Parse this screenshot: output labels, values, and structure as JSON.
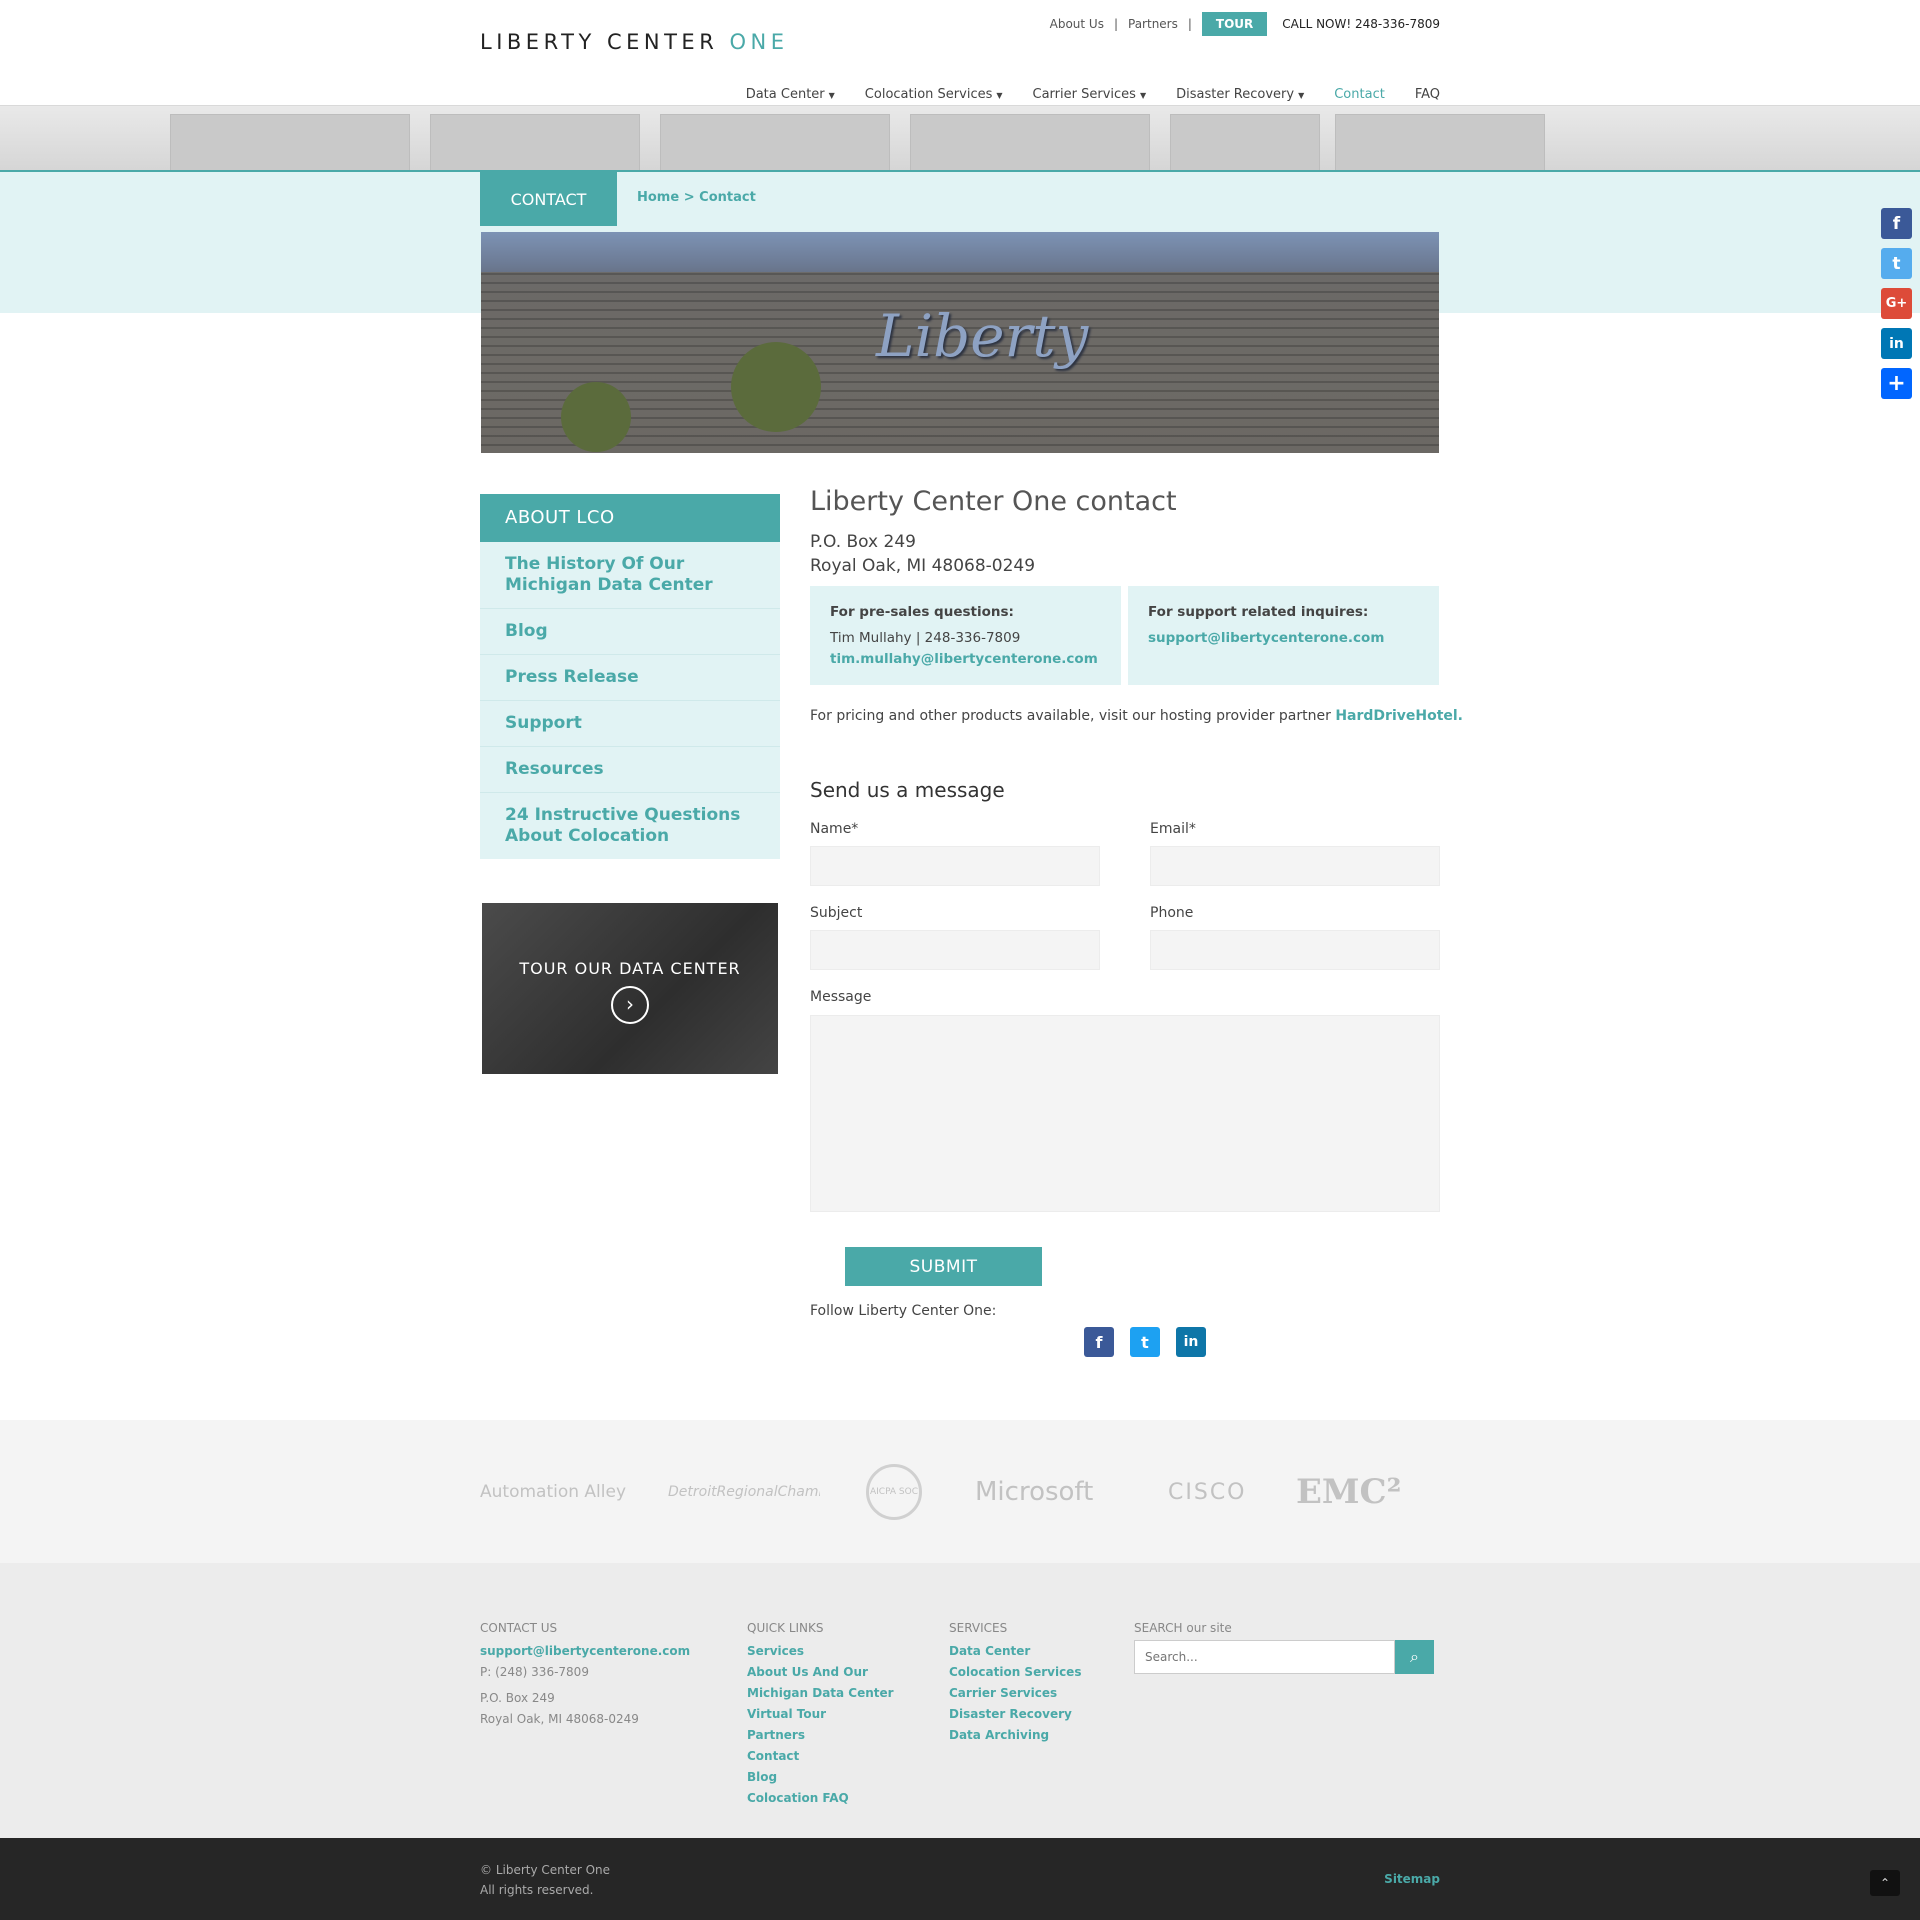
{
  "header": {
    "logo_text": "LIBERTY CENTER ",
    "logo_accent": "ONE",
    "top_links": [
      "About Us",
      "Partners"
    ],
    "tour_label": "TOUR",
    "call_now": "CALL NOW! 248-336-7809",
    "nav": [
      {
        "label": "Data Center"
      },
      {
        "label": "Colocation Services"
      },
      {
        "label": "Carrier Services"
      },
      {
        "label": "Disaster Recovery"
      },
      {
        "label": "Contact"
      },
      {
        "label": "FAQ"
      }
    ]
  },
  "page_tab": "CONTACT",
  "breadcrumb": {
    "home": "Home",
    "sep": ">",
    "current": "Contact"
  },
  "banner_text": "Liberty",
  "sidebar": {
    "heading": "ABOUT LCO",
    "items": [
      "The History Of Our Michigan Data Center",
      "Blog",
      "Press Release",
      "Support",
      "Resources",
      "24 Instructive Questions About Colocation"
    ],
    "tour_box": "TOUR OUR DATA CENTER"
  },
  "main": {
    "title": "Liberty Center One contact",
    "address_line1": "P.O. Box 249",
    "address_line2": "Royal Oak, MI 48068-0249",
    "presales": {
      "heading": "For pre-sales questions:",
      "contact": "Tim Mullahy | 248-336-7809",
      "email": "tim.mullahy@libertycenterone.com"
    },
    "support": {
      "heading": "For support related inquires:",
      "email": "support@libertycenterone.com"
    },
    "pricing_text": "For pricing and other products available, visit our hosting provider partner ",
    "pricing_link": "HardDriveHotel.",
    "form": {
      "title": "Send us a message",
      "name_label": "Name*",
      "email_label": "Email*",
      "subject_label": "Subject",
      "phone_label": "Phone",
      "message_label": "Message",
      "submit_label": "SUBMIT"
    },
    "follow_label": "Follow Liberty Center One:"
  },
  "partners": [
    "Automation Alley",
    "DetroitRegionalChamber",
    "AICPA SOC",
    "Microsoft",
    "CISCO",
    "EMC²"
  ],
  "footer": {
    "contact": {
      "heading": "CONTACT US",
      "email": "support@libertycenterone.com",
      "phone": "P: (248) 336-7809",
      "address1": "P.O. Box 249",
      "address2": "Royal Oak, MI 48068-0249"
    },
    "quick_links": {
      "heading": "QUICK LINKS",
      "items": [
        "Services",
        "About Us And Our",
        "Michigan Data Center",
        "Virtual Tour",
        "Partners",
        "Contact",
        "Blog",
        "Colocation FAQ"
      ]
    },
    "services": {
      "heading": "SERVICES",
      "items": [
        "Data Center",
        "Colocation Services",
        "Carrier Services",
        "Disaster Recovery",
        "Data Archiving"
      ]
    },
    "search": {
      "heading": "SEARCH our site",
      "placeholder": "Search..."
    },
    "copyright": "© Liberty Center One",
    "rights": "All rights reserved.",
    "sitemap": "Sitemap"
  },
  "colors": {
    "accent": "#4aa9a8",
    "light_band": "#e1f3f4",
    "footer_dark": "#262626"
  }
}
